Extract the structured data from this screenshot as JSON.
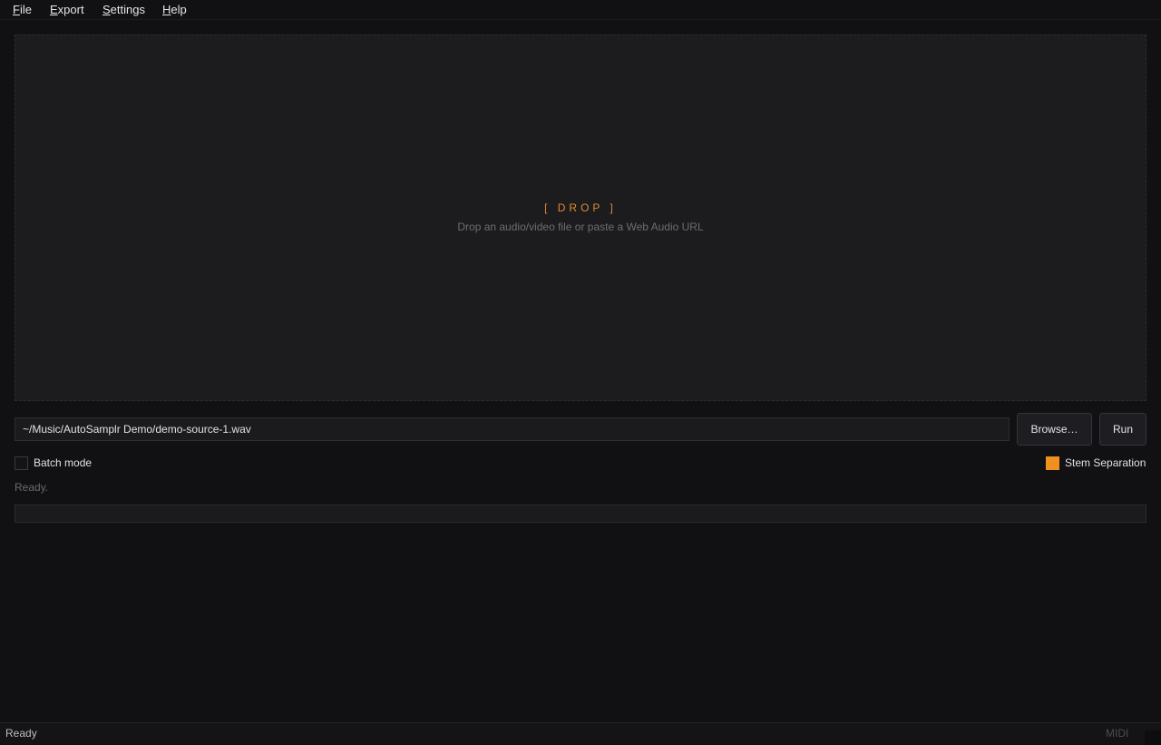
{
  "menu": {
    "file": {
      "first": "F",
      "rest": "ile"
    },
    "export": {
      "first": "E",
      "rest": "xport"
    },
    "settings": {
      "first": "S",
      "rest": "ettings"
    },
    "help": {
      "first": "H",
      "rest": "elp"
    }
  },
  "dropzone": {
    "title": "[ DROP ]",
    "subtitle": "Drop an audio/video file or paste a Web Audio URL"
  },
  "source": {
    "path_value": "~/Music/AutoSamplr Demo/demo-source-1.wav"
  },
  "buttons": {
    "browse_label": "Browse…",
    "run_label": "Run"
  },
  "options": {
    "batch_mode_label": "Batch mode",
    "batch_mode_checked": false,
    "stem_separation_label": "Stem Separation",
    "stem_separation_checked": true
  },
  "status": {
    "message": "Ready.",
    "progress_fraction": 0
  },
  "statusbar": {
    "left_text": "Ready",
    "midi_label": "MIDI"
  },
  "colors": {
    "accent": "#f0901f",
    "background": "#111114",
    "panel": "#1c1c1f"
  }
}
